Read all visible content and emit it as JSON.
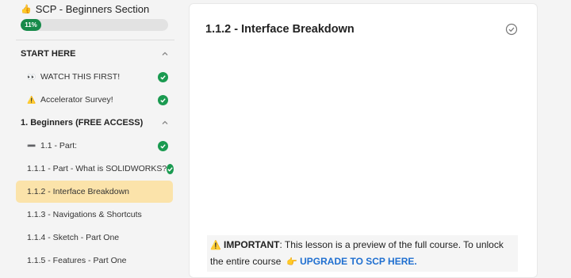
{
  "sidebar": {
    "course_title": "SCP - Beginners Section",
    "course_emoji": "👍",
    "progress": {
      "percent": 11,
      "label": "11%"
    },
    "sections": [
      {
        "label": "START HERE",
        "lessons": [
          {
            "emoji": "👀",
            "label": "WATCH THIS FIRST!",
            "completed": true
          },
          {
            "emoji": "⚠️",
            "label": "Accelerator Survey!",
            "completed": true
          }
        ]
      },
      {
        "label": "1. Beginners (FREE ACCESS)",
        "lessons": [
          {
            "emoji": "➖",
            "label": "1.1 - Part:",
            "completed": true
          },
          {
            "emoji": "",
            "label": "1.1.1 - Part - What is SOLIDWORKS?",
            "completed": true
          },
          {
            "emoji": "",
            "label": "1.1.2 - Interface Breakdown",
            "completed": false,
            "active": true
          },
          {
            "emoji": "",
            "label": "1.1.3 - Navigations & Shortcuts",
            "completed": false
          },
          {
            "emoji": "",
            "label": "1.1.4 - Sketch - Part One",
            "completed": false
          },
          {
            "emoji": "",
            "label": "1.1.5 - Features - Part One",
            "completed": false
          }
        ]
      }
    ]
  },
  "main": {
    "lesson_title": "1.1.2 - Interface Breakdown",
    "notice": {
      "warning_emoji": "⚠️",
      "important_label": "IMPORTANT",
      "text": ": This lesson is a preview of the full course. To unlock the entire course",
      "pointer_emoji": "👉",
      "link_text": "UPGRADE TO SCP HERE."
    }
  },
  "colors": {
    "progress_fill": "#178a4a",
    "check_green": "#1a9a50",
    "active_row": "#fbe3aa",
    "link_blue": "#1f6fd0"
  }
}
